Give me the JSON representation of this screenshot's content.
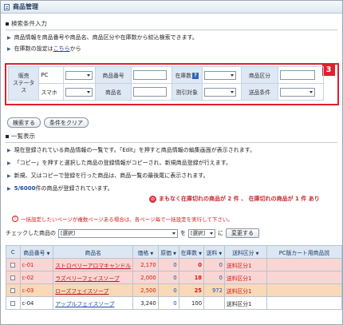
{
  "window": {
    "title": "商品管理"
  },
  "search_section": {
    "heading": "検索条件入力",
    "desc1": "商品情報を商品番号や商品名、商品区分や在庫数から絞込検索できます。",
    "desc2_prefix": "在庫数の設定は",
    "desc2_link": "こちら",
    "desc2_suffix": "から"
  },
  "badge": "3",
  "filters": {
    "sales_status": "販売\nステータス",
    "pc": "PC",
    "smartphone": "スマホ",
    "product_number": "商品番号",
    "product_name": "商品名",
    "stock_count": "在庫数",
    "help": "?",
    "discount_target": "割引対象",
    "product_category": "商品区分",
    "shipping_condition": "送品条件"
  },
  "buttons": {
    "search": "検索する",
    "clear": "条件をクリア",
    "change": "変更する"
  },
  "list_section": {
    "heading": "一覧表示",
    "info1": "現在登録されている商品情報の一覧です。「Edit」を押すと商品情報の編集画面が表示されます。",
    "info2": "「コピー」を押すと選択した商品の登録情報がコピーされ、新規商品登録が行えます。",
    "info3": "新規、又はコピーで登録を行った商品は、商品一覧の最後尾に表示されます。",
    "count": "5/6000",
    "count_suffix": "件の商品が登録されています。",
    "stock_warning": "まもなく在庫切れの商品が 2 件 、 在庫切れの商品が 1 件 あり",
    "bulk_note": "一括設定したいページが複数ページある場合は、各ページ毎で一括設定を実行して下さい。",
    "checked_prefix": "チェックした商品の",
    "select_placeholder": "[選択]",
    "wo": "を",
    "ni": "に"
  },
  "table": {
    "headers": [
      "C",
      "商品番号",
      "商品名",
      "価格",
      "原価",
      "在庫数",
      "送料",
      "送料区分",
      "PC版カート用商品説"
    ],
    "rows": [
      {
        "no": "c-01",
        "name": "ストロベリーアロマキャンドル",
        "price": "2,170",
        "cost": "0",
        "stock": "0",
        "shipping": "0",
        "ship_class": "送料区分1",
        "style": "red"
      },
      {
        "no": "c-02",
        "name": "ラズベリーフェイスソープ",
        "price": "2,000",
        "cost": "0",
        "stock": "18",
        "shipping": "0",
        "ship_class": "送料区分1",
        "style": "red"
      },
      {
        "no": "c-03",
        "name": "ローズフェイスソープ",
        "price": "2,500",
        "cost": "0",
        "stock": "25",
        "shipping": "972",
        "ship_class": "送料区分1",
        "style": "orange"
      },
      {
        "no": "c-04",
        "name": "アップルフェイスソープ",
        "price": "3,240",
        "cost": "0",
        "stock": "100",
        "shipping": "",
        "ship_class": "送料区分1",
        "style": "white"
      }
    ]
  },
  "colors": {
    "accent_red": "#e0202c",
    "header_blue": "#dde7f3",
    "row_red": "#f9d6d3",
    "row_orange": "#f9d9b7",
    "link": "#1a4ea1"
  }
}
